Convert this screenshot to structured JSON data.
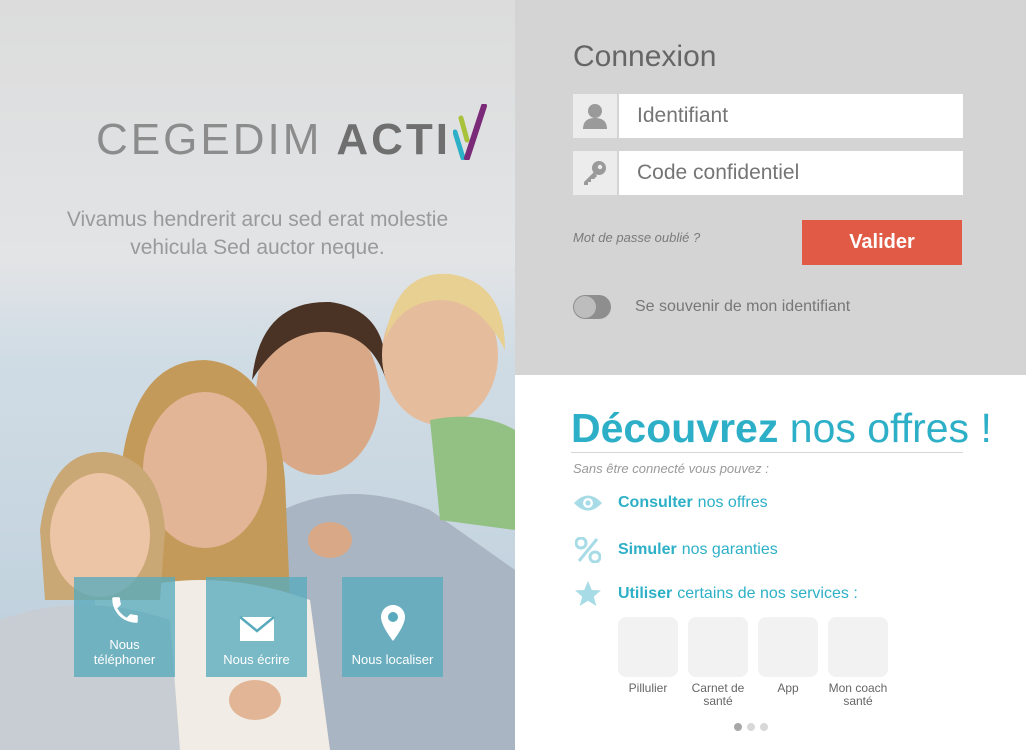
{
  "brand": {
    "word1": "CEGEDIM",
    "word2": "ACTI"
  },
  "tagline": {
    "line1": "Vivamus hendrerit arcu sed erat molestie",
    "line2": "vehicula Sed auctor neque."
  },
  "quick_actions": [
    {
      "line1": "Nous",
      "line2": "téléphoner",
      "icon": "phone-icon"
    },
    {
      "label": "Nous écrire",
      "icon": "envelope-icon"
    },
    {
      "label": "Nous localiser",
      "icon": "location-pin-icon"
    }
  ],
  "login": {
    "title": "Connexion",
    "username_placeholder": "Identifiant",
    "password_placeholder": "Code confidentiel",
    "forgot": "Mot de passe oublié ?",
    "submit": "Valider",
    "remember": "Se souvenir de mon identifiant"
  },
  "offers": {
    "title_bold": "Découvrez",
    "title_rest": " nos offres !",
    "subtitle": "Sans être connecté vous pouvez :",
    "items": [
      {
        "bold": "Consulter",
        "rest": "nos offres",
        "icon": "eye-icon"
      },
      {
        "bold": "Simuler",
        "rest": "nos garanties",
        "icon": "percent-icon"
      },
      {
        "bold": "Utiliser",
        "rest": "certains de nos services :",
        "icon": "star-icon"
      }
    ],
    "services": [
      {
        "line1": "Pillulier",
        "line2": ""
      },
      {
        "line1": "Carnet de",
        "line2": "santé"
      },
      {
        "line1": "App",
        "line2": ""
      },
      {
        "line1": "Mon coach",
        "line2": "santé"
      }
    ],
    "carousel": {
      "pages": 3,
      "active": 1
    }
  },
  "colors": {
    "accent": "#2db0c7",
    "button": "#e05a46",
    "quick_tile": "#58aabc",
    "login_bg": "#d4d4d4"
  }
}
